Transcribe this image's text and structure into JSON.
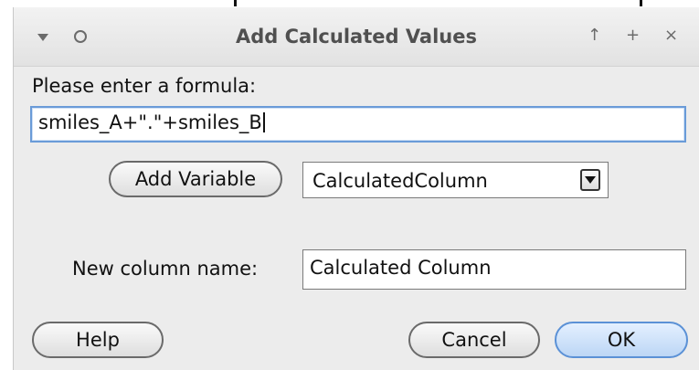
{
  "dialog": {
    "title": "Add Calculated Values",
    "titlebar_icons": {
      "menu": "triangle-down-icon",
      "pin": "circle-icon",
      "up": "↑",
      "add": "+",
      "close": "×"
    }
  },
  "formula": {
    "prompt": "Please enter a formula:",
    "value": "smiles_A+\".\"+smiles_B"
  },
  "variable": {
    "add_label": "Add Variable",
    "selected": "CalculatedColumn"
  },
  "new_column": {
    "label": "New column name:",
    "value": "Calculated Column"
  },
  "buttons": {
    "help": "Help",
    "cancel": "Cancel",
    "ok": "OK"
  },
  "colors": {
    "focus_border": "#6a9bd8",
    "ok_button": "#bcd6f5"
  }
}
